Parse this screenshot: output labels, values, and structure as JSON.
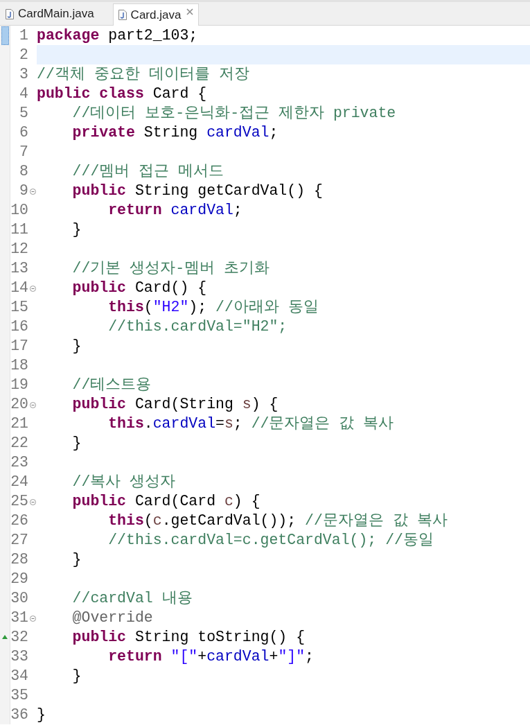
{
  "tabs": [
    {
      "label": "CardMain.java",
      "selected": false
    },
    {
      "label": "Card.java",
      "selected": true
    }
  ],
  "editor": {
    "lines": [
      {
        "number": "1",
        "tokens": [
          {
            "kind": "keyword",
            "text": "package"
          },
          {
            "kind": "plain",
            "text": " part2_103;"
          }
        ],
        "current": false,
        "fold": false,
        "override": false,
        "ruler_mark": true
      },
      {
        "number": "2",
        "current": true,
        "fold": false,
        "override": false,
        "ruler_mark": false
      },
      {
        "number": "3",
        "tokens": [
          {
            "kind": "comment",
            "text": "//객체 중요한 데이터를 저장"
          }
        ],
        "current": false,
        "fold": false,
        "override": false,
        "ruler_mark": false
      },
      {
        "number": "4",
        "tokens": [
          {
            "kind": "keyword",
            "text": "public class"
          },
          {
            "kind": "plain",
            "text": " Card {"
          }
        ],
        "current": false,
        "fold": false,
        "override": false,
        "ruler_mark": false,
        "children": [
          {
            "number": "5",
            "tokens": [
              {
                "kind": "comment",
                "text": "//데이터 보호-은닉화-접근 제한자 private"
              }
            ],
            "current": false,
            "fold": false,
            "override": false,
            "ruler_mark": false
          },
          {
            "number": "6",
            "tokens": [
              {
                "kind": "keyword",
                "text": "private"
              },
              {
                "kind": "plain",
                "text": " String "
              },
              {
                "kind": "field",
                "text": "cardVal"
              },
              {
                "kind": "plain",
                "text": ";"
              }
            ],
            "current": false,
            "fold": false,
            "override": false,
            "ruler_mark": false
          },
          {
            "number": "7",
            "current": false,
            "fold": false,
            "override": false,
            "ruler_mark": false
          },
          {
            "number": "8",
            "tokens": [
              {
                "kind": "comment",
                "text": "///멤버 접근 메서드"
              }
            ],
            "current": false,
            "fold": false,
            "override": false,
            "ruler_mark": false
          },
          {
            "number": "9",
            "tokens": [
              {
                "kind": "keyword",
                "text": "public"
              },
              {
                "kind": "plain",
                "text": " String getCardVal() {"
              }
            ],
            "current": false,
            "fold": true,
            "override": false,
            "ruler_mark": false,
            "children": [
              {
                "number": "10",
                "tokens": [
                  {
                    "kind": "keyword",
                    "text": "return "
                  },
                  {
                    "kind": "field",
                    "text": "cardVal"
                  },
                  {
                    "kind": "plain",
                    "text": ";"
                  }
                ],
                "current": false,
                "fold": false,
                "override": false,
                "ruler_mark": false
              }
            ]
          },
          {
            "number": "11",
            "tokens": [
              {
                "kind": "plain",
                "text": "}"
              }
            ],
            "current": false,
            "fold": false,
            "override": false,
            "ruler_mark": false
          },
          {
            "number": "12",
            "current": false,
            "fold": false,
            "override": false,
            "ruler_mark": false
          },
          {
            "number": "13",
            "tokens": [
              {
                "kind": "comment",
                "text": "//기본 생성자-멤버 초기화"
              }
            ],
            "current": false,
            "fold": false,
            "override": false,
            "ruler_mark": false
          },
          {
            "number": "14",
            "tokens": [
              {
                "kind": "keyword",
                "text": "public"
              },
              {
                "kind": "plain",
                "text": " Card() {"
              }
            ],
            "current": false,
            "fold": true,
            "override": false,
            "ruler_mark": false,
            "children": [
              {
                "number": "15",
                "tokens": [
                  {
                    "kind": "keyword",
                    "text": "this"
                  },
                  {
                    "kind": "plain",
                    "text": "("
                  },
                  {
                    "kind": "string",
                    "text": "\"H2\""
                  },
                  {
                    "kind": "plain",
                    "text": "); "
                  },
                  {
                    "kind": "comment",
                    "text": "//아래와 동일"
                  }
                ],
                "current": false,
                "fold": false,
                "override": false,
                "ruler_mark": false
              },
              {
                "number": "16",
                "tokens": [
                  {
                    "kind": "comment",
                    "text": "//this.cardVal=\"H2\";"
                  }
                ],
                "current": false,
                "fold": false,
                "override": false,
                "ruler_mark": false
              }
            ]
          },
          {
            "number": "17",
            "tokens": [
              {
                "kind": "plain",
                "text": "}"
              }
            ],
            "current": false,
            "fold": false,
            "override": false,
            "ruler_mark": false
          },
          {
            "number": "18",
            "current": false,
            "fold": false,
            "override": false,
            "ruler_mark": false
          },
          {
            "number": "19",
            "tokens": [
              {
                "kind": "comment",
                "text": "//테스트용"
              }
            ],
            "current": false,
            "fold": false,
            "override": false,
            "ruler_mark": false
          },
          {
            "number": "20",
            "tokens": [
              {
                "kind": "keyword",
                "text": "public"
              },
              {
                "kind": "plain",
                "text": " Card(String "
              },
              {
                "kind": "parameter",
                "text": "s"
              },
              {
                "kind": "plain",
                "text": ") {"
              }
            ],
            "current": false,
            "fold": true,
            "override": false,
            "ruler_mark": false,
            "children": [
              {
                "number": "21",
                "tokens": [
                  {
                    "kind": "keyword",
                    "text": "this"
                  },
                  {
                    "kind": "plain",
                    "text": "."
                  },
                  {
                    "kind": "field",
                    "text": "cardVal"
                  },
                  {
                    "kind": "plain",
                    "text": "="
                  },
                  {
                    "kind": "parameter",
                    "text": "s"
                  },
                  {
                    "kind": "plain",
                    "text": "; "
                  },
                  {
                    "kind": "comment",
                    "text": "//문자열은 값 복사"
                  }
                ],
                "current": false,
                "fold": false,
                "override": false,
                "ruler_mark": false
              }
            ]
          },
          {
            "number": "22",
            "tokens": [
              {
                "kind": "plain",
                "text": "}"
              }
            ],
            "current": false,
            "fold": false,
            "override": false,
            "ruler_mark": false
          },
          {
            "number": "23",
            "current": false,
            "fold": false,
            "override": false,
            "ruler_mark": false
          },
          {
            "number": "24",
            "tokens": [
              {
                "kind": "comment",
                "text": "//복사 생성자"
              }
            ],
            "current": false,
            "fold": false,
            "override": false,
            "ruler_mark": false
          },
          {
            "number": "25",
            "tokens": [
              {
                "kind": "keyword",
                "text": "public"
              },
              {
                "kind": "plain",
                "text": " Card(Card "
              },
              {
                "kind": "parameter",
                "text": "c"
              },
              {
                "kind": "plain",
                "text": ") {"
              }
            ],
            "current": false,
            "fold": true,
            "override": false,
            "ruler_mark": false,
            "children": [
              {
                "number": "26",
                "tokens": [
                  {
                    "kind": "keyword",
                    "text": "this"
                  },
                  {
                    "kind": "plain",
                    "text": "("
                  },
                  {
                    "kind": "parameter",
                    "text": "c"
                  },
                  {
                    "kind": "plain",
                    "text": ".getCardVal()); "
                  },
                  {
                    "kind": "comment",
                    "text": "//문자열은 값 복사"
                  }
                ],
                "current": false,
                "fold": false,
                "override": false,
                "ruler_mark": false
              },
              {
                "number": "27",
                "tokens": [
                  {
                    "kind": "comment",
                    "text": "//this.cardVal=c.getCardVal(); //동일"
                  }
                ],
                "current": false,
                "fold": false,
                "override": false,
                "ruler_mark": false
              }
            ]
          },
          {
            "number": "28",
            "tokens": [
              {
                "kind": "plain",
                "text": "}"
              }
            ],
            "current": false,
            "fold": false,
            "override": false,
            "ruler_mark": false
          },
          {
            "number": "29",
            "current": false,
            "fold": false,
            "override": false,
            "ruler_mark": false
          },
          {
            "number": "30",
            "tokens": [
              {
                "kind": "comment",
                "text": "//cardVal 내용"
              }
            ],
            "current": false,
            "fold": false,
            "override": false,
            "ruler_mark": false
          },
          {
            "number": "31",
            "tokens": [
              {
                "kind": "annotation",
                "text": "@Override"
              }
            ],
            "current": false,
            "fold": true,
            "override": false,
            "ruler_mark": false
          },
          {
            "number": "32",
            "tokens": [
              {
                "kind": "keyword",
                "text": "public"
              },
              {
                "kind": "plain",
                "text": " String toString() {"
              }
            ],
            "current": false,
            "fold": false,
            "override": true,
            "ruler_mark": false,
            "children": [
              {
                "number": "33",
                "tokens": [
                  {
                    "kind": "keyword",
                    "text": "return "
                  },
                  {
                    "kind": "string",
                    "text": "\"[\""
                  },
                  {
                    "kind": "plain",
                    "text": "+"
                  },
                  {
                    "kind": "field",
                    "text": "cardVal"
                  },
                  {
                    "kind": "plain",
                    "text": "+"
                  },
                  {
                    "kind": "string",
                    "text": "\"]\""
                  },
                  {
                    "kind": "plain",
                    "text": ";"
                  }
                ],
                "current": false,
                "fold": false,
                "override": false,
                "ruler_mark": false
              }
            ]
          },
          {
            "number": "34",
            "tokens": [
              {
                "kind": "plain",
                "text": "}"
              }
            ],
            "current": false,
            "fold": false,
            "override": false,
            "ruler_mark": false
          },
          {
            "number": "35",
            "current": false,
            "fold": false,
            "override": false,
            "ruler_mark": false
          }
        ]
      },
      {
        "number": "36",
        "tokens": [
          {
            "kind": "plain",
            "text": "}"
          }
        ],
        "current": false,
        "fold": false,
        "override": false,
        "ruler_mark": false
      }
    ]
  }
}
